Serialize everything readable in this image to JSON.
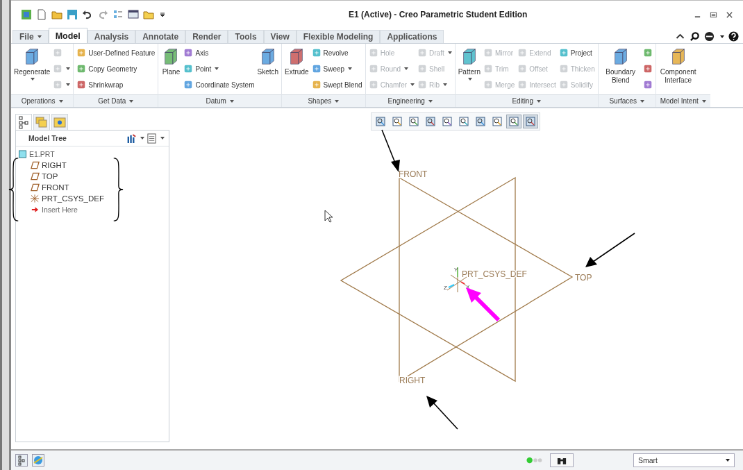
{
  "window": {
    "title": "E1 (Active) - Creo Parametric Student Edition"
  },
  "tabs": [
    {
      "label": "File",
      "selected": false,
      "menu": true
    },
    {
      "label": "Model",
      "selected": true,
      "menu": false
    },
    {
      "label": "Analysis",
      "selected": false,
      "menu": false
    },
    {
      "label": "Annotate",
      "selected": false,
      "menu": false
    },
    {
      "label": "Render",
      "selected": false,
      "menu": false
    },
    {
      "label": "Tools",
      "selected": false,
      "menu": false
    },
    {
      "label": "View",
      "selected": false,
      "menu": false
    },
    {
      "label": "Flexible Modeling",
      "selected": false,
      "menu": false
    },
    {
      "label": "Applications",
      "selected": false,
      "menu": false
    }
  ],
  "ribbon_groups": [
    {
      "label": "Operations",
      "columns": [
        {
          "kind": "large",
          "items": [
            {
              "label": "Regenerate",
              "disabled": false,
              "menu": true
            }
          ]
        },
        {
          "kind": "stack",
          "items": [
            {
              "disabled": true,
              "menu": false
            },
            {
              "disabled": true,
              "menu": true
            },
            {
              "disabled": true,
              "menu": true
            }
          ]
        }
      ]
    },
    {
      "label": "Get Data",
      "columns": [
        {
          "kind": "stack",
          "items": [
            {
              "label": "User-Defined Feature",
              "disabled": false,
              "menu": false
            },
            {
              "label": "Copy Geometry",
              "disabled": false,
              "menu": false
            },
            {
              "label": "Shrinkwrap",
              "disabled": false,
              "menu": false
            }
          ]
        }
      ]
    },
    {
      "label": "Datum",
      "columns": [
        {
          "kind": "large",
          "items": [
            {
              "label": "Plane",
              "disabled": false,
              "menu": false
            }
          ]
        },
        {
          "kind": "stack",
          "items": [
            {
              "label": "Axis",
              "disabled": false,
              "menu": false
            },
            {
              "label": "Point",
              "disabled": false,
              "menu": true
            },
            {
              "label": "Coordinate System",
              "disabled": false,
              "menu": false
            }
          ]
        },
        {
          "kind": "large",
          "items": [
            {
              "label": "Sketch",
              "disabled": false,
              "menu": false
            }
          ]
        }
      ]
    },
    {
      "label": "Shapes",
      "columns": [
        {
          "kind": "large",
          "items": [
            {
              "label": "Extrude",
              "disabled": false,
              "menu": false
            }
          ]
        },
        {
          "kind": "stack",
          "items": [
            {
              "label": "Revolve",
              "disabled": false,
              "menu": false
            },
            {
              "label": "Sweep",
              "disabled": false,
              "menu": true
            },
            {
              "label": "Swept Blend",
              "disabled": false,
              "menu": false
            }
          ]
        }
      ]
    },
    {
      "label": "Engineering",
      "columns": [
        {
          "kind": "stack",
          "items": [
            {
              "label": "Hole",
              "disabled": true,
              "menu": false
            },
            {
              "label": "Round",
              "disabled": true,
              "menu": true
            },
            {
              "label": "Chamfer",
              "disabled": true,
              "menu": true
            }
          ]
        },
        {
          "kind": "stack",
          "items": [
            {
              "label": "Draft",
              "disabled": true,
              "menu": true
            },
            {
              "label": "Shell",
              "disabled": true,
              "menu": false
            },
            {
              "label": "Rib",
              "disabled": true,
              "menu": true
            }
          ]
        }
      ]
    },
    {
      "label": "Editing",
      "columns": [
        {
          "kind": "large",
          "items": [
            {
              "label": "Pattern",
              "disabled": false,
              "menu": true
            }
          ]
        },
        {
          "kind": "stack",
          "items": [
            {
              "label": "Mirror",
              "disabled": true,
              "menu": false
            },
            {
              "label": "Trim",
              "disabled": true,
              "menu": false
            },
            {
              "label": "Merge",
              "disabled": true,
              "menu": false
            }
          ]
        },
        {
          "kind": "stack",
          "items": [
            {
              "label": "Extend",
              "disabled": true,
              "menu": false
            },
            {
              "label": "Offset",
              "disabled": true,
              "menu": false
            },
            {
              "label": "Intersect",
              "disabled": true,
              "menu": false
            }
          ]
        },
        {
          "kind": "stack",
          "items": [
            {
              "label": "Project",
              "disabled": false,
              "menu": false
            },
            {
              "label": "Thicken",
              "disabled": true,
              "menu": false
            },
            {
              "label": "Solidify",
              "disabled": true,
              "menu": false
            }
          ]
        }
      ]
    },
    {
      "label": "Surfaces",
      "columns": [
        {
          "kind": "large",
          "items": [
            {
              "label": "Boundary Blend",
              "disabled": false,
              "menu": false
            }
          ]
        },
        {
          "kind": "stack",
          "items": [
            {
              "disabled": false,
              "menu": false
            },
            {
              "disabled": false,
              "menu": false
            },
            {
              "disabled": false,
              "menu": false
            }
          ]
        }
      ]
    },
    {
      "label": "Model Intent",
      "columns": [
        {
          "kind": "large",
          "items": [
            {
              "label": "Component Interface",
              "disabled": false,
              "menu": false
            }
          ]
        }
      ]
    }
  ],
  "model_tree": {
    "title": "Model Tree",
    "items": [
      {
        "label": "E1.PRT",
        "kind": "part",
        "children": [
          {
            "label": "RIGHT",
            "kind": "plane"
          },
          {
            "label": "TOP",
            "kind": "plane"
          },
          {
            "label": "FRONT",
            "kind": "plane"
          },
          {
            "label": "PRT_CSYS_DEF",
            "kind": "csys"
          },
          {
            "label": "Insert Here",
            "kind": "insert"
          }
        ]
      }
    ]
  },
  "view_toolbar": [
    {
      "on": false
    },
    {
      "on": false
    },
    {
      "on": false
    },
    {
      "on": false
    },
    {
      "on": false
    },
    {
      "on": false
    },
    {
      "on": false
    },
    {
      "on": false
    },
    {
      "on": true
    },
    {
      "on": true
    }
  ],
  "graphics": {
    "labels": [
      {
        "text": "FRONT"
      },
      {
        "text": "TOP"
      },
      {
        "text": "RIGHT"
      },
      {
        "text": "PRT_CSYS_DEF"
      }
    ],
    "axes": [
      "X",
      "Y",
      "Z"
    ]
  },
  "status_bar": {
    "filter": {
      "value": "Smart"
    }
  }
}
